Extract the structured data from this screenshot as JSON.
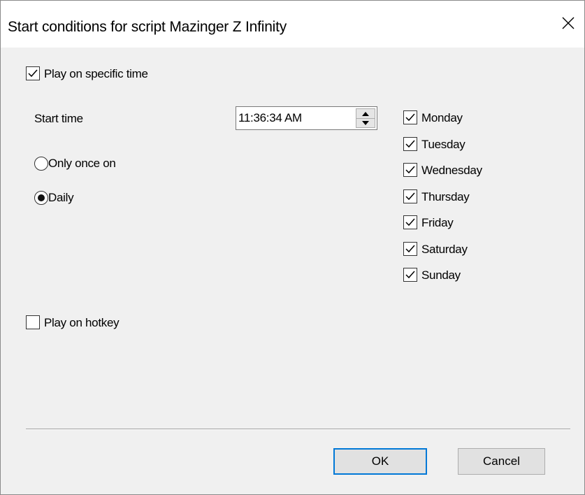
{
  "window": {
    "title": "Start conditions for script Mazinger Z Infinity",
    "close_glyph": "✕"
  },
  "specific_time": {
    "label": "Play on specific time",
    "checked": true,
    "start_time_label": "Start time",
    "start_time_value": "11:36:34 AM",
    "once_label": "Only once on",
    "once_selected": false,
    "daily_label": "Daily",
    "daily_selected": true
  },
  "days": [
    {
      "label": "Monday",
      "checked": true
    },
    {
      "label": "Tuesday",
      "checked": true
    },
    {
      "label": "Wednesday",
      "checked": true
    },
    {
      "label": "Thursday",
      "checked": true
    },
    {
      "label": "Friday",
      "checked": true
    },
    {
      "label": "Saturday",
      "checked": true
    },
    {
      "label": "Sunday",
      "checked": true
    }
  ],
  "hotkey": {
    "label": "Play on hotkey",
    "checked": false
  },
  "buttons": {
    "ok_label": "OK",
    "cancel_label": "Cancel"
  },
  "icons": {
    "close": "close-icon",
    "check": "checkmark-icon",
    "spin_up": "triangle-up-icon",
    "spin_down": "triangle-down-icon"
  },
  "colors": {
    "default_button_border": "#0078d7",
    "dialog_background": "#f0f0f0"
  }
}
